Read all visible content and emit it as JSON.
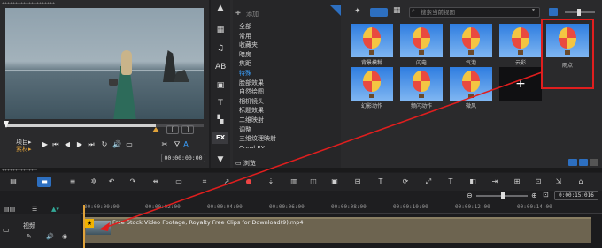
{
  "preview": {
    "mode_project": "项目▸",
    "mode_clip": "素材▸",
    "timecode": "00:00:00:00",
    "in_mark": "[",
    "out_mark": "]",
    "volume_label": "A"
  },
  "library": {
    "add_label": "添加",
    "search_placeholder": "搜索当前视图",
    "categories": [
      "全部",
      "常用",
      "收藏夹",
      "暗房",
      "焦距",
      "特殊",
      "脸部效果",
      "自然绘图",
      "相机镜头",
      "标题效果",
      "二维映射",
      "调整",
      "三维纹理映射",
      "Corel FX"
    ],
    "active_category_index": 5,
    "browse_label": "浏览",
    "thumbnails": [
      {
        "label": "背景模糊"
      },
      {
        "label": "闪电"
      },
      {
        "label": "气泡"
      },
      {
        "label": "云彩"
      },
      {
        "label": "雨点"
      },
      {
        "label": "幻影动作"
      },
      {
        "label": "频闪动作"
      },
      {
        "label": "微风"
      }
    ],
    "highlight_color": "#e01e1e",
    "accent_color": "#2d6fc0"
  },
  "timeline": {
    "timecode": "0:00:15:016",
    "ruler": [
      "00:00:00:00",
      "00:00:02:00",
      "00:00:04:00",
      "00:00:06:00",
      "00:00:08:00",
      "00:00:10:00",
      "00:00:12:00",
      "00:00:14:00"
    ],
    "track_name": "视频",
    "clip_title": "Free Stock Video Footage, Royalty Free Clips for Download(9).mp4",
    "playhead_color": "#e0a23a"
  }
}
